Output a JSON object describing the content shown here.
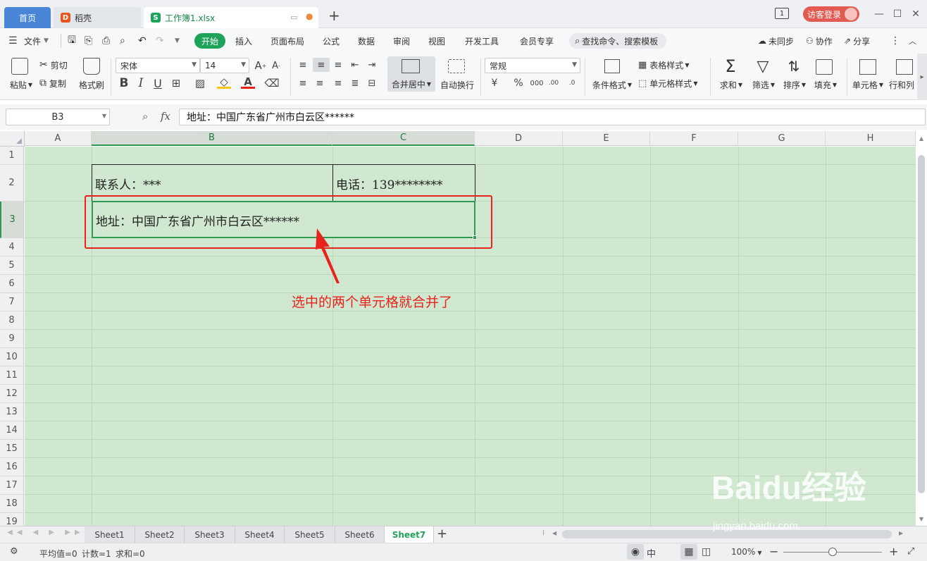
{
  "tabs": {
    "home": "首页",
    "daoke": "稻壳",
    "file": "工作簿1.xlsx"
  },
  "titlebar": {
    "login": "访客登录",
    "badge": "1"
  },
  "menu": {
    "file": "文件",
    "items": [
      "开始",
      "插入",
      "页面布局",
      "公式",
      "数据",
      "审阅",
      "视图",
      "开发工具",
      "会员专享"
    ],
    "search": "查找命令、搜索模板",
    "sync": "未同步",
    "collab": "协作",
    "share": "分享"
  },
  "ribbon": {
    "paste": "粘贴",
    "cut": "剪切",
    "copy": "复制",
    "format_painter": "格式刷",
    "font_name": "宋体",
    "font_size": "14",
    "bold": "B",
    "italic": "I",
    "underline": "U",
    "merge_center": "合并居中",
    "wrap": "自动换行",
    "number_format": "常规",
    "cond_format": "条件格式",
    "table_style": "表格样式",
    "cell_style": "单元格样式",
    "sum": "求和",
    "filter": "筛选",
    "sort": "排序",
    "fill": "填充",
    "cell": "单元格",
    "rowcol": "行和列"
  },
  "formula_bar": {
    "name_box": "B3",
    "fx": "fx",
    "content": "地址：中国广东省广州市白云区******"
  },
  "columns": [
    "A",
    "B",
    "C",
    "D",
    "E",
    "F",
    "G",
    "H"
  ],
  "rows": [
    "1",
    "2",
    "3",
    "4",
    "5",
    "6",
    "7",
    "8",
    "9",
    "10",
    "11",
    "12",
    "13",
    "14",
    "15",
    "16",
    "17",
    "18",
    "19"
  ],
  "cells": {
    "b2": "联系人：***",
    "c2": "电话：139********",
    "b3": "地址：中国广东省广州市白云区******"
  },
  "annotation": "选中的两个单元格就合并了",
  "sheets": [
    "Sheet1",
    "Sheet2",
    "Sheet3",
    "Sheet4",
    "Sheet5",
    "Sheet6",
    "Sheet7"
  ],
  "active_sheet": "Sheet7",
  "status": {
    "average": "平均值=0",
    "count": "计数=1",
    "sum": "求和=0",
    "zoom": "100%"
  },
  "watermark": {
    "brand": "Baidu经验",
    "url": "jingyan.baidu.com"
  }
}
